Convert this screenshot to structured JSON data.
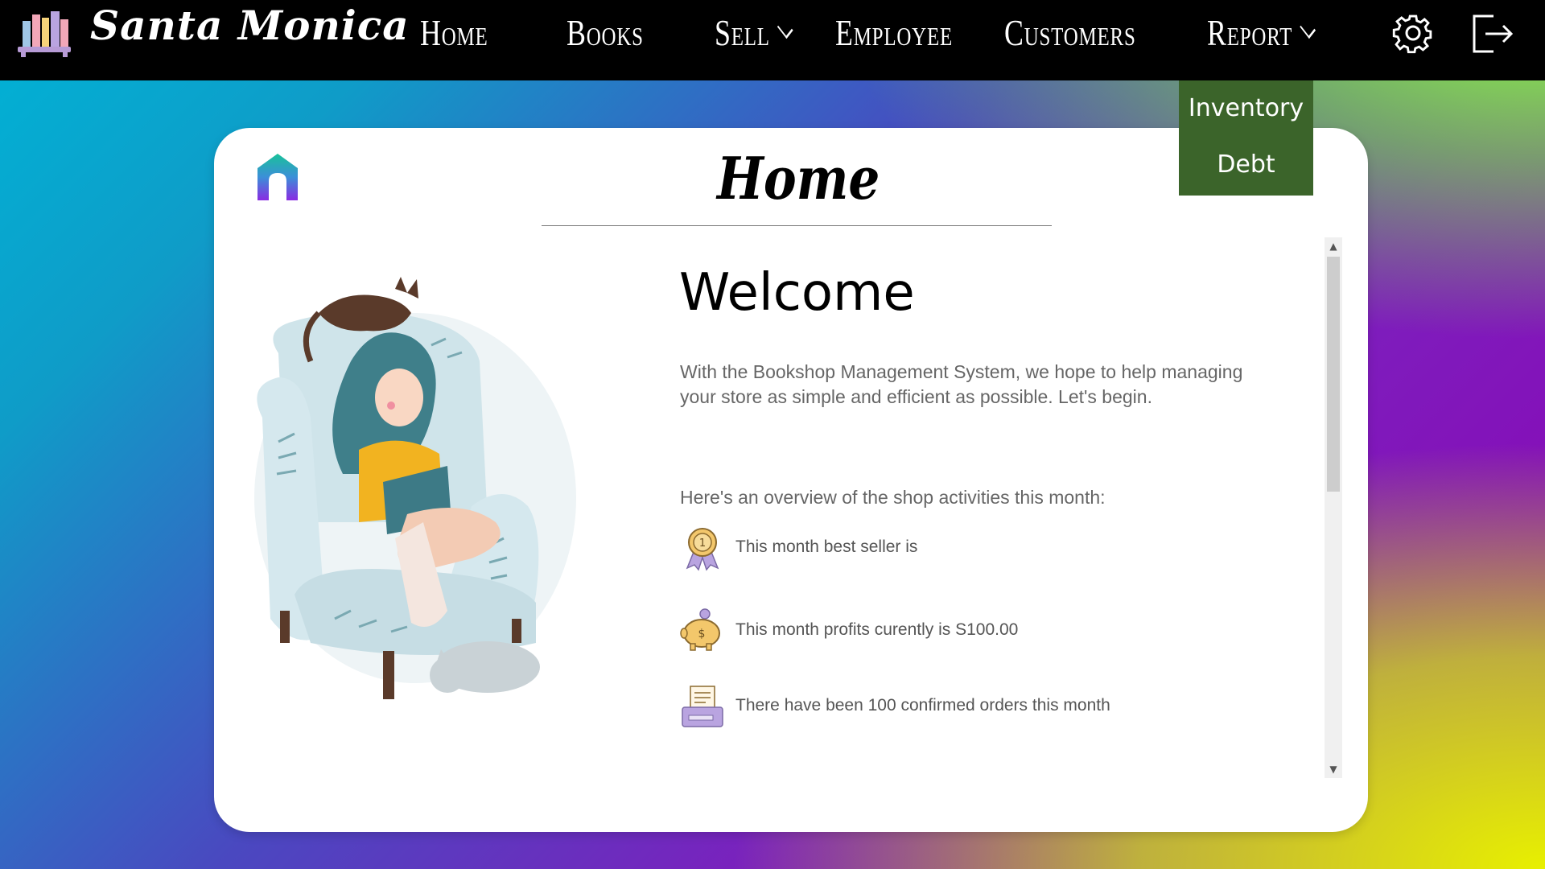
{
  "app": {
    "brand": "Santa Monica"
  },
  "nav": {
    "home": "Home",
    "books": "Books",
    "sell": "Sell",
    "employee": "Employee",
    "customers": "Customers",
    "report": "Report"
  },
  "report_menu": {
    "items": [
      "Inventory",
      "Debt"
    ]
  },
  "page": {
    "title": "Home",
    "welcome": "Welcome",
    "intro": "With the Bookshop Management System, we hope to help managing your store as simple and efficient as possible. Let's begin.",
    "overview": "Here's an overview of the shop activities this month:",
    "stats": [
      {
        "icon": "medal-icon",
        "text": "This month best seller is"
      },
      {
        "icon": "piggy-bank-icon",
        "text": "This month profits curently is S100.00"
      },
      {
        "icon": "receipt-printer-icon",
        "text": "There have been 100 confirmed orders this month"
      }
    ]
  },
  "colors": {
    "topbar": "#000000",
    "dropdown": "#3b642a",
    "card": "#ffffff",
    "text_muted": "#666666"
  }
}
